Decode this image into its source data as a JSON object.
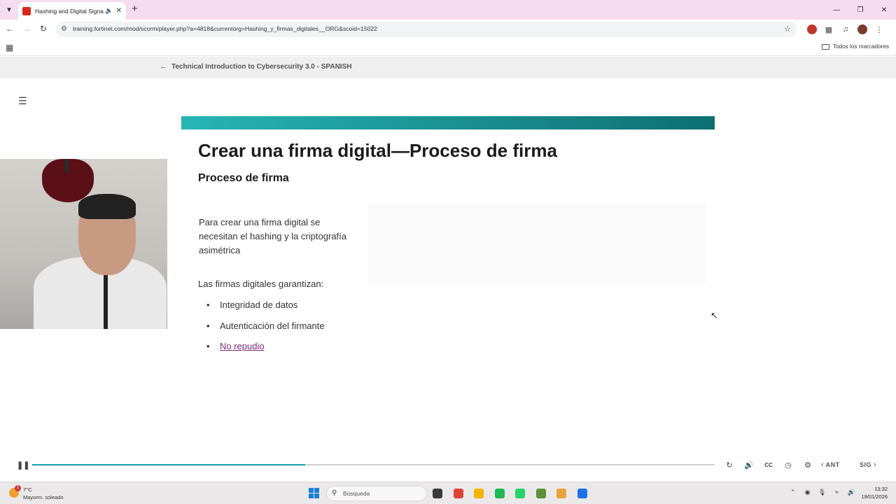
{
  "browser": {
    "tab_title": "Hashing and Digital Signati",
    "url": "training.fortinet.com/mod/scorm/player.php?a=4818&currentorg=Hashing_y_firmas_digitales__ORG&scoid=15022",
    "all_bookmarks_label": "Todos los marcadores",
    "icons": {
      "tab_menu": "chevron-down-icon",
      "favicon": "fortinet-favicon-icon",
      "audio": "speaker-icon",
      "close": "close-icon",
      "new_tab": "plus-icon",
      "back": "back-arrow-icon",
      "forward": "forward-arrow-icon",
      "reload": "reload-icon",
      "site_info": "tune-icon",
      "bookmark": "star-icon",
      "extension": "extension-badge-icon",
      "puzzle": "puzzle-icon",
      "media": "media-control-icon",
      "profile": "avatar",
      "menu": "kebab-menu-icon",
      "apps": "apps-grid-icon",
      "folder": "folder-icon"
    }
  },
  "course": {
    "header_title": "Technical Introduction to Cybersecurity 3.0 - SPANISH"
  },
  "slide": {
    "title": "Crear una firma digital—Proceso de firma",
    "subtitle": "Proceso de firma",
    "paragraph": "Para crear una firma digital se necesitan el hashing y la criptografía asimétrica",
    "guarantee_label": "Las firmas digitales garantizan:",
    "bullets": [
      "Integridad de datos",
      "Autenticación del firmante",
      "No repudio"
    ],
    "banner_colors": [
      "#27b5b5",
      "#0e6f72"
    ]
  },
  "player": {
    "progress_fraction": 0.4,
    "prev_label": "ANT",
    "next_label": "SIG",
    "icons": [
      "replay-icon",
      "volume-icon",
      "captions-icon",
      "playback-speed-icon",
      "settings-icon"
    ]
  },
  "taskbar": {
    "weather_temp": "7°C",
    "weather_desc": "Mayorm. soleado",
    "weather_badge": "1",
    "search_placeholder": "Búsqueda",
    "time": "13:32",
    "date": "19/01/2026",
    "apps": [
      {
        "name": "task-view-icon",
        "color": "#3a3a3a"
      },
      {
        "name": "chrome-icon",
        "color": "#db4437"
      },
      {
        "name": "file-explorer-icon",
        "color": "#f4b400"
      },
      {
        "name": "spotify-icon",
        "color": "#1db954"
      },
      {
        "name": "whatsapp-icon",
        "color": "#25d366"
      },
      {
        "name": "vs-icon",
        "color": "#5c8f3a"
      },
      {
        "name": "paint-icon",
        "color": "#e8a33a"
      },
      {
        "name": "chrome-active-icon",
        "color": "#1a73e8"
      }
    ]
  }
}
